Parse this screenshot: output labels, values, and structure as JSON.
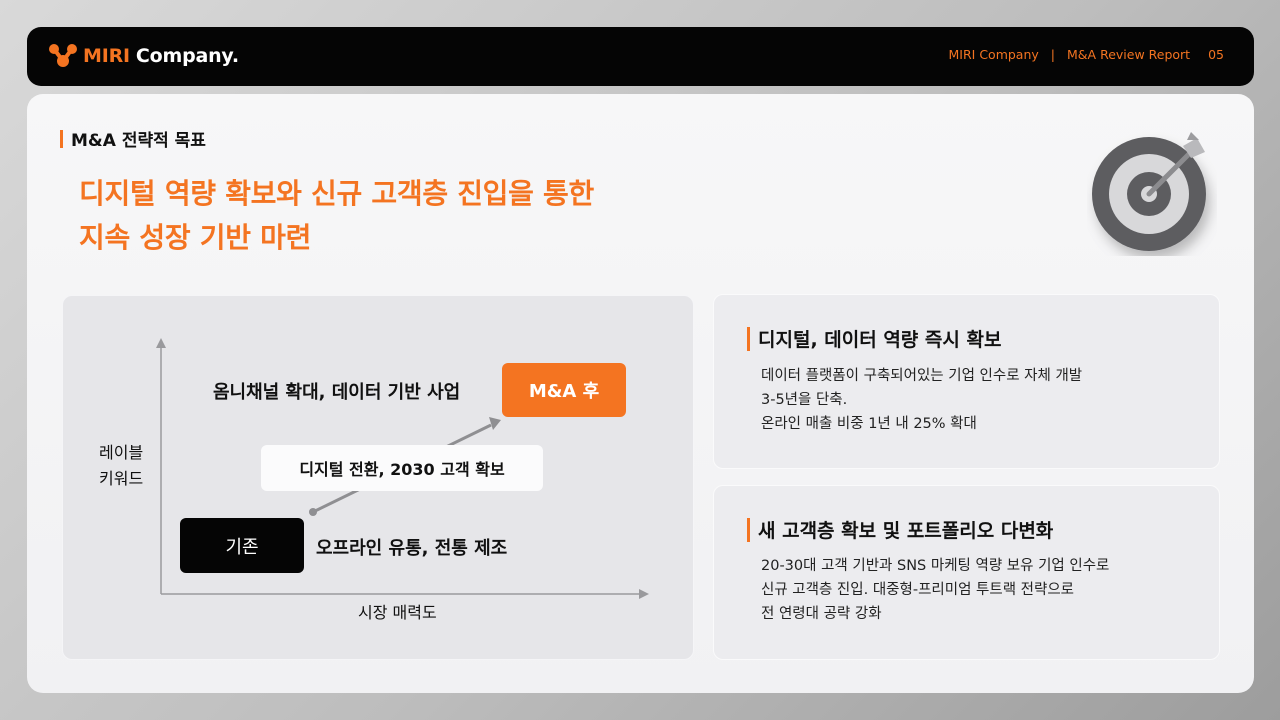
{
  "header": {
    "brand_highlight": "MIRI",
    "brand_rest": "Company.",
    "company": "MIRI Company",
    "separator": "|",
    "report": "M&A Review Report",
    "page": "05"
  },
  "section": {
    "label": "M&A 전략적 목표",
    "headline_line1": "디지털 역량 확보와 신규 고객층 진입을 통한",
    "headline_line2": "지속 성장 기반 마련"
  },
  "diagram": {
    "y_label_line1": "레이블",
    "y_label_line2": "키워드",
    "x_label": "시장 매력도",
    "top_text": "옴니채널 확대, 데이터 기반 사업",
    "after_badge": "M&A 후",
    "middle_text": "디지털 전환, 2030 고객 확보",
    "before_badge": "기존",
    "bottom_text": "오프라인 유통, 전통 제조"
  },
  "cards": [
    {
      "title": "디지털, 데이터 역량 즉시 확보",
      "lines": [
        "데이터 플랫폼이 구축되어있는 기업 인수로 자체 개발",
        "3-5년을 단축.",
        "온라인 매출 비중 1년 내 25% 확대"
      ]
    },
    {
      "title": "새 고객층 확보 및 포트폴리오 다변화",
      "lines": [
        "20-30대 고객 기반과 SNS 마케팅 역량 보유 기업 인수로",
        "신규 고객층 진입. 대중형-프리미엄 투트랙 전략으로",
        "전 연령대 공략 강화"
      ]
    }
  ],
  "colors": {
    "accent": "#f47421",
    "dark": "#050505",
    "panel": "#f4f4f6"
  },
  "icons": {
    "logo": "people-group-icon",
    "target": "target-dart-icon"
  }
}
